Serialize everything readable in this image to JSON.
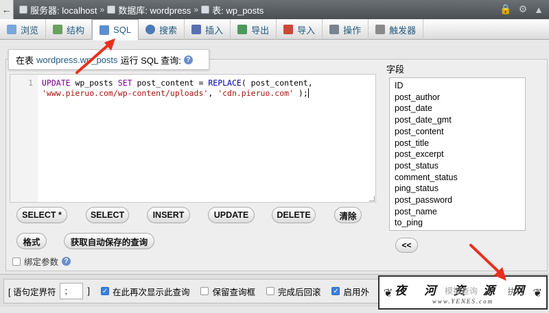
{
  "breadcrumb": {
    "back": "←",
    "server_label": "服务器: localhost",
    "db_label": "数据库: wordpress",
    "table_label": "表: wp_posts"
  },
  "tabs": [
    {
      "label": "浏览",
      "icon": "browse-icon",
      "color": "#7aa6d8"
    },
    {
      "label": "结构",
      "icon": "structure-icon",
      "color": "#6aa060"
    },
    {
      "label": "SQL",
      "icon": "sql-icon",
      "color": "#5b8fcf"
    },
    {
      "label": "搜索",
      "icon": "search-icon",
      "color": "#4a7ab8"
    },
    {
      "label": "插入",
      "icon": "insert-icon",
      "color": "#5a6fb0"
    },
    {
      "label": "导出",
      "icon": "export-icon",
      "color": "#4a9a5a"
    },
    {
      "label": "导入",
      "icon": "import-icon",
      "color": "#c84a3a"
    },
    {
      "label": "操作",
      "icon": "wrench-icon",
      "color": "#7a8390"
    },
    {
      "label": "触发器",
      "icon": "trigger-icon",
      "color": "#8a8a8a"
    }
  ],
  "query_header": {
    "prefix": "在表",
    "table": "wordpress.wp_posts",
    "suffix": "运行 SQL 查询:"
  },
  "editor": {
    "line_number": "1",
    "code_line1": [
      "UPDATE",
      " wp_posts ",
      "SET",
      " post_content = ",
      "REPLACE",
      "( post_content,"
    ],
    "code_line2": [
      "'www.pieruo.com/wp-content/uploads'",
      ", ",
      "'cdn.pieruo.com'",
      " );"
    ]
  },
  "fields": {
    "label": "字段",
    "items": [
      "ID",
      "post_author",
      "post_date",
      "post_date_gmt",
      "post_content",
      "post_title",
      "post_excerpt",
      "post_status",
      "comment_status",
      "ping_status",
      "post_password",
      "post_name",
      "to_ping"
    ],
    "insert_button": "<<"
  },
  "buttons": {
    "select_star": "SELECT *",
    "select": "SELECT",
    "insert": "INSERT",
    "update": "UPDATE",
    "delete": "DELETE",
    "clear": "清除",
    "format": "格式",
    "get_autosaved": "获取自动保存的查询"
  },
  "bind_params": "绑定参数",
  "bottom": {
    "delimiter_label": "[ 语句定界符",
    "delimiter_value": ";",
    "delimiter_close": "]",
    "show_again": "在此再次显示此查询",
    "show_again_checked": true,
    "keep_box": "保留查询框",
    "keep_box_checked": false,
    "rollback": "完成后回滚",
    "rollback_checked": false,
    "foreign_keys": "启用外",
    "foreign_keys_checked": true,
    "simulate": "模拟查询",
    "execute": "执行"
  },
  "watermark": {
    "title": "夜 河 资 源 网",
    "url": "www.YENES.com"
  }
}
